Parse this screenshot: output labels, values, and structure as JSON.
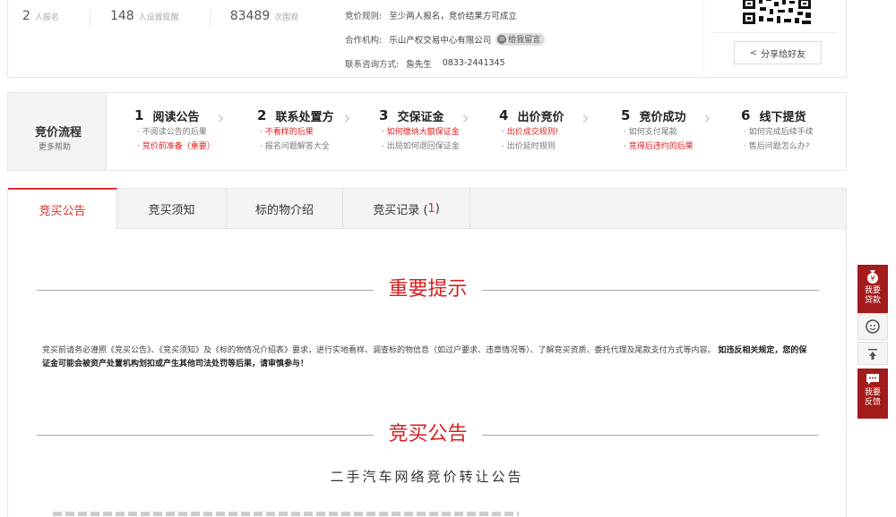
{
  "stats": [
    {
      "num": "2",
      "unit": "人报名"
    },
    {
      "num": "148",
      "unit": "人设置提醒"
    },
    {
      "num": "83489",
      "unit": "次围观"
    }
  ],
  "info": {
    "rule_label": "竞价规则:",
    "rule_value": "至少两人报名，竞价结果方可成立",
    "org_label": "合作机构:",
    "org_value": "乐山产权交易中心有限公司",
    "msg_badge": "给我留言",
    "contact_label": "联系咨询方式:",
    "contact_name": "詹先生",
    "contact_phone": "0833-2441345"
  },
  "share_label": "分享给好友",
  "process": {
    "title": "竞价流程",
    "more": "更多帮助",
    "steps": [
      {
        "n": "1",
        "name": "阅读公告",
        "links": [
          {
            "text": "不阅读公告的后果",
            "red": false
          },
          {
            "text": "竞价前准备（重要）",
            "red": true
          }
        ]
      },
      {
        "n": "2",
        "name": "联系处置方",
        "links": [
          {
            "text": "不看样的后果",
            "red": true
          },
          {
            "text": "报名问题解答大全",
            "red": false
          }
        ]
      },
      {
        "n": "3",
        "name": "交保证金",
        "links": [
          {
            "text": "如何缴纳大额保证金",
            "red": true
          },
          {
            "text": "出局如何退回保证金",
            "red": false
          }
        ]
      },
      {
        "n": "4",
        "name": "出价竞价",
        "links": [
          {
            "text": "出价成交规则!",
            "red": true
          },
          {
            "text": "出价延时规则",
            "red": false
          }
        ]
      },
      {
        "n": "5",
        "name": "竞价成功",
        "links": [
          {
            "text": "如何支付尾款",
            "red": false
          },
          {
            "text": "竞得后违约的后果",
            "red": true
          }
        ]
      },
      {
        "n": "6",
        "name": "线下提货",
        "links": [
          {
            "text": "如何完成后续手续",
            "red": false
          },
          {
            "text": "售后问题怎么办?",
            "red": false
          }
        ]
      }
    ]
  },
  "tabs": [
    {
      "label": "竞买公告",
      "count": ""
    },
    {
      "label": "竞买须知",
      "count": ""
    },
    {
      "label": "标的物介绍",
      "count": ""
    },
    {
      "label": "竞买记录 (",
      "count": "1"
    }
  ],
  "tab_close": ")",
  "sections": {
    "important_title": "重要提示",
    "notice_text": "竞买前请务必遵照《竞买公告》、《竞买须知》及《标的物情况介绍表》要求，进行实地看样、调查标的物信息（如过户要求、违章情况等）、了解竞买资质、委托代理及尾款支付方式等内容。",
    "notice_bold": "如违反相关规定，您的保证金可能会被资产处置机构划扣或产生其他司法处罚等后果，请审慎参与！",
    "announce_title": "竞买公告",
    "doc_title": "二手汽车网络竞价转让公告"
  },
  "side": {
    "loan": "我要贷款",
    "report": "我要反馈"
  },
  "colors": {
    "accent": "#d93030",
    "side": "#a31b1b"
  }
}
